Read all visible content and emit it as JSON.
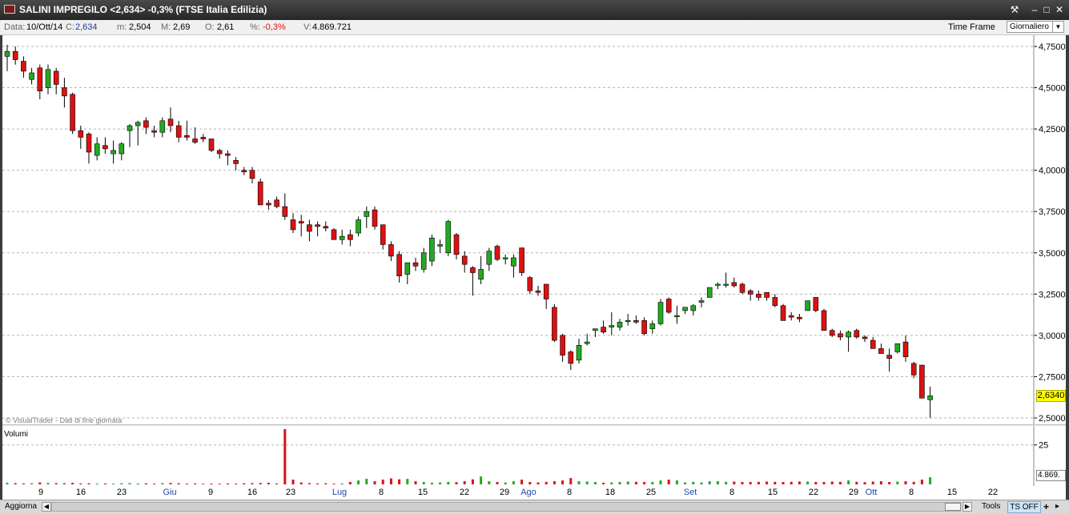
{
  "window": {
    "title": "SALINI IMPREGILO <2,634> -0,3%  (FTSE Italia Edilizia)",
    "buttons": [
      "⚒",
      "–",
      "□",
      "✕"
    ]
  },
  "infobar": {
    "data_label": "Data:",
    "data_value": "10/Ott/14",
    "c_label": "C:",
    "c_value": "2,634",
    "m_label": "m:",
    "m_value": "2,504",
    "M_label": "M:",
    "M_value": "2,69",
    "o_label": "O:",
    "o_value": "2,61",
    "pct_label": "%:",
    "pct_value": "-0,3%",
    "v_label": "V:",
    "v_value": "4.869.721",
    "timeframe_label": "Time Frame",
    "timeframe_value": "Giornaliero"
  },
  "copyright": "© VisualTrader - Dati di fine giornata",
  "volume_label": "Volumi",
  "current_price_label": "2,6340",
  "current_volume_label": "4.869.",
  "bottombar": {
    "refresh": "Aggiorna",
    "tools": "Tools",
    "ts": "TS OFF",
    "plus": "+",
    "menu": "▸"
  },
  "colors": {
    "up": "#22aa22",
    "down": "#dd1111",
    "grid": "#b5b5b5",
    "month": "#2244aa"
  },
  "chart_data": {
    "type": "candlestick",
    "title": "SALINI IMPREGILO",
    "price_axis": {
      "min": 2.5,
      "max": 4.75,
      "ticks": [
        "2,5000",
        "2,7500",
        "3,0000",
        "3,2500",
        "3,5000",
        "3,7500",
        "4,0000",
        "4,2500",
        "4,5000",
        "4,7500"
      ]
    },
    "volume_axis": {
      "ticks": [
        "25"
      ]
    },
    "x_ticks": [
      {
        "label": "9",
        "month": false
      },
      {
        "label": "16",
        "month": false
      },
      {
        "label": "23",
        "month": false
      },
      {
        "label": "Giu",
        "month": true
      },
      {
        "label": "9",
        "month": false
      },
      {
        "label": "16",
        "month": false
      },
      {
        "label": "23",
        "month": false
      },
      {
        "label": "Lug",
        "month": true
      },
      {
        "label": "8",
        "month": false
      },
      {
        "label": "15",
        "month": false
      },
      {
        "label": "22",
        "month": false
      },
      {
        "label": "29",
        "month": false
      },
      {
        "label": "Ago",
        "month": true
      },
      {
        "label": "8",
        "month": false
      },
      {
        "label": "18",
        "month": false
      },
      {
        "label": "25",
        "month": false
      },
      {
        "label": "Set",
        "month": true
      },
      {
        "label": "8",
        "month": false
      },
      {
        "label": "15",
        "month": false
      },
      {
        "label": "22",
        "month": false
      },
      {
        "label": "29",
        "month": false
      },
      {
        "label": "Ott",
        "month": true
      },
      {
        "label": "8",
        "month": false
      },
      {
        "label": "15",
        "month": false
      },
      {
        "label": "22",
        "month": false
      }
    ],
    "candles": [
      [
        4.69,
        4.76,
        4.6,
        4.72
      ],
      [
        4.72,
        4.75,
        4.64,
        4.67
      ],
      [
        4.66,
        4.69,
        4.56,
        4.6
      ],
      [
        4.55,
        4.62,
        4.52,
        4.59
      ],
      [
        4.62,
        4.64,
        4.43,
        4.48
      ],
      [
        4.5,
        4.64,
        4.46,
        4.61
      ],
      [
        4.6,
        4.62,
        4.46,
        4.52
      ],
      [
        4.5,
        4.56,
        4.38,
        4.45
      ],
      [
        4.46,
        4.47,
        4.22,
        4.24
      ],
      [
        4.24,
        4.27,
        4.13,
        4.2
      ],
      [
        4.22,
        4.23,
        4.04,
        4.11
      ],
      [
        4.09,
        4.2,
        4.06,
        4.16
      ],
      [
        4.15,
        4.2,
        4.1,
        4.13
      ],
      [
        4.1,
        4.18,
        4.04,
        4.12
      ],
      [
        4.1,
        4.17,
        4.06,
        4.16
      ],
      [
        4.24,
        4.28,
        4.14,
        4.27
      ],
      [
        4.27,
        4.3,
        4.15,
        4.29
      ],
      [
        4.3,
        4.32,
        4.22,
        4.26
      ],
      [
        4.24,
        4.27,
        4.2,
        4.23
      ],
      [
        4.23,
        4.32,
        4.2,
        4.3
      ],
      [
        4.31,
        4.38,
        4.23,
        4.27
      ],
      [
        4.27,
        4.3,
        4.17,
        4.2
      ],
      [
        4.21,
        4.3,
        4.18,
        4.2
      ],
      [
        4.19,
        4.26,
        4.16,
        4.17
      ],
      [
        4.2,
        4.22,
        4.17,
        4.19
      ],
      [
        4.19,
        4.19,
        4.11,
        4.12
      ],
      [
        4.12,
        4.13,
        4.07,
        4.1
      ],
      [
        4.1,
        4.12,
        4.03,
        4.09
      ],
      [
        4.06,
        4.08,
        4.0,
        4.04
      ],
      [
        4.0,
        4.02,
        3.97,
        3.99
      ],
      [
        4.0,
        4.02,
        3.92,
        3.95
      ],
      [
        3.93,
        3.95,
        3.8,
        3.79
      ],
      [
        3.8,
        3.82,
        3.76,
        3.79
      ],
      [
        3.82,
        3.84,
        3.77,
        3.78
      ],
      [
        3.78,
        3.86,
        3.7,
        3.72
      ],
      [
        3.7,
        3.74,
        3.62,
        3.64
      ],
      [
        3.69,
        3.73,
        3.6,
        3.68
      ],
      [
        3.67,
        3.7,
        3.57,
        3.63
      ],
      [
        3.67,
        3.69,
        3.6,
        3.66
      ],
      [
        3.66,
        3.69,
        3.63,
        3.65
      ],
      [
        3.64,
        3.65,
        3.58,
        3.58
      ],
      [
        3.58,
        3.64,
        3.55,
        3.6
      ],
      [
        3.61,
        3.64,
        3.54,
        3.58
      ],
      [
        3.62,
        3.72,
        3.6,
        3.7
      ],
      [
        3.72,
        3.78,
        3.65,
        3.75
      ],
      [
        3.76,
        3.78,
        3.64,
        3.66
      ],
      [
        3.67,
        3.67,
        3.52,
        3.55
      ],
      [
        3.55,
        3.57,
        3.45,
        3.48
      ],
      [
        3.49,
        3.51,
        3.32,
        3.36
      ],
      [
        3.37,
        3.44,
        3.31,
        3.44
      ],
      [
        3.44,
        3.47,
        3.39,
        3.42
      ],
      [
        3.4,
        3.53,
        3.38,
        3.5
      ],
      [
        3.45,
        3.61,
        3.42,
        3.59
      ],
      [
        3.54,
        3.58,
        3.5,
        3.55
      ],
      [
        3.5,
        3.7,
        3.48,
        3.69
      ],
      [
        3.61,
        3.62,
        3.46,
        3.49
      ],
      [
        3.48,
        3.51,
        3.38,
        3.43
      ],
      [
        3.41,
        3.42,
        3.24,
        3.38
      ],
      [
        3.34,
        3.48,
        3.31,
        3.4
      ],
      [
        3.43,
        3.53,
        3.39,
        3.51
      ],
      [
        3.54,
        3.55,
        3.45,
        3.46
      ],
      [
        3.47,
        3.49,
        3.43,
        3.47
      ],
      [
        3.42,
        3.49,
        3.35,
        3.47
      ],
      [
        3.53,
        3.53,
        3.36,
        3.38
      ],
      [
        3.35,
        3.36,
        3.25,
        3.27
      ],
      [
        3.27,
        3.3,
        3.24,
        3.26
      ],
      [
        3.31,
        3.31,
        3.16,
        3.22
      ],
      [
        3.17,
        3.19,
        2.96,
        2.97
      ],
      [
        3.0,
        3.01,
        2.84,
        2.88
      ],
      [
        2.9,
        2.91,
        2.79,
        2.83
      ],
      [
        2.85,
        2.98,
        2.83,
        2.94
      ],
      [
        2.95,
        3.01,
        2.94,
        2.96
      ],
      [
        3.03,
        3.04,
        2.99,
        3.04
      ],
      [
        3.05,
        3.09,
        3.01,
        3.02
      ],
      [
        3.05,
        3.14,
        3.0,
        3.06
      ],
      [
        3.05,
        3.1,
        3.03,
        3.08
      ],
      [
        3.09,
        3.13,
        3.06,
        3.09
      ],
      [
        3.09,
        3.12,
        3.07,
        3.08
      ],
      [
        3.09,
        3.11,
        3.0,
        3.01
      ],
      [
        3.04,
        3.09,
        3.01,
        3.07
      ],
      [
        3.07,
        3.22,
        3.06,
        3.2
      ],
      [
        3.22,
        3.23,
        3.13,
        3.14
      ],
      [
        3.12,
        3.18,
        3.07,
        3.12
      ],
      [
        3.15,
        3.17,
        3.13,
        3.17
      ],
      [
        3.15,
        3.19,
        3.12,
        3.18
      ],
      [
        3.2,
        3.23,
        3.17,
        3.21
      ],
      [
        3.23,
        3.29,
        3.23,
        3.29
      ],
      [
        3.31,
        3.32,
        3.28,
        3.31
      ],
      [
        3.31,
        3.38,
        3.29,
        3.31
      ],
      [
        3.32,
        3.35,
        3.29,
        3.3
      ],
      [
        3.31,
        3.32,
        3.25,
        3.26
      ],
      [
        3.27,
        3.28,
        3.21,
        3.25
      ],
      [
        3.25,
        3.27,
        3.21,
        3.23
      ],
      [
        3.26,
        3.26,
        3.21,
        3.23
      ],
      [
        3.23,
        3.25,
        3.17,
        3.18
      ],
      [
        3.18,
        3.19,
        3.09,
        3.09
      ],
      [
        3.12,
        3.14,
        3.09,
        3.11
      ],
      [
        3.11,
        3.13,
        3.08,
        3.1
      ],
      [
        3.15,
        3.21,
        3.15,
        3.21
      ],
      [
        3.23,
        3.23,
        3.14,
        3.15
      ],
      [
        3.15,
        3.16,
        3.03,
        3.03
      ],
      [
        3.03,
        3.04,
        2.99,
        3.0
      ],
      [
        3.01,
        3.03,
        2.97,
        2.99
      ],
      [
        2.99,
        3.03,
        2.9,
        3.02
      ],
      [
        3.03,
        3.04,
        2.98,
        2.99
      ],
      [
        2.99,
        3.0,
        2.96,
        2.98
      ],
      [
        2.97,
        2.99,
        2.93,
        2.92
      ],
      [
        2.92,
        2.95,
        2.89,
        2.89
      ],
      [
        2.88,
        2.92,
        2.78,
        2.86
      ],
      [
        2.9,
        2.95,
        2.89,
        2.95
      ],
      [
        2.96,
        3.0,
        2.84,
        2.87
      ],
      [
        2.83,
        2.84,
        2.74,
        2.76
      ],
      [
        2.82,
        2.82,
        2.63,
        2.62
      ],
      [
        2.61,
        2.69,
        2.5,
        2.634
      ]
    ],
    "volumes": [
      1.0,
      0.8,
      0.6,
      0.7,
      1.2,
      0.9,
      0.8,
      0.7,
      1.0,
      0.6,
      0.7,
      0.5,
      0.6,
      0.5,
      0.7,
      0.8,
      0.6,
      0.7,
      0.5,
      0.8,
      0.9,
      0.7,
      0.5,
      0.6,
      0.4,
      0.5,
      0.4,
      0.6,
      0.5,
      0.7,
      0.8,
      0.9,
      1.0,
      0.6,
      35.0,
      3.0,
      1.2,
      0.8,
      0.6,
      0.7,
      0.5,
      0.6,
      1.5,
      2.5,
      3.5,
      2.0,
      3.0,
      3.8,
      3.2,
      3.5,
      2.0,
      1.5,
      1.0,
      1.2,
      1.6,
      1.4,
      2.0,
      3.2,
      5.0,
      2.0,
      1.5,
      1.2,
      2.0,
      3.0,
      1.5,
      1.2,
      1.6,
      2.0,
      2.5,
      4.0,
      2.0,
      1.8,
      1.5,
      1.0,
      1.2,
      1.5,
      1.8,
      1.6,
      1.5,
      1.5,
      2.5,
      3.0,
      2.5,
      1.2,
      1.6,
      1.2,
      2.0,
      2.0,
      1.6,
      1.8,
      1.5,
      1.5,
      1.6,
      1.8,
      1.6,
      1.5,
      1.6,
      1.8,
      1.8,
      1.5,
      1.5,
      1.8,
      1.6,
      2.5,
      1.6,
      1.4,
      1.8,
      2.0,
      1.5,
      1.8,
      2.0,
      1.6,
      3.0,
      4.5
    ]
  }
}
